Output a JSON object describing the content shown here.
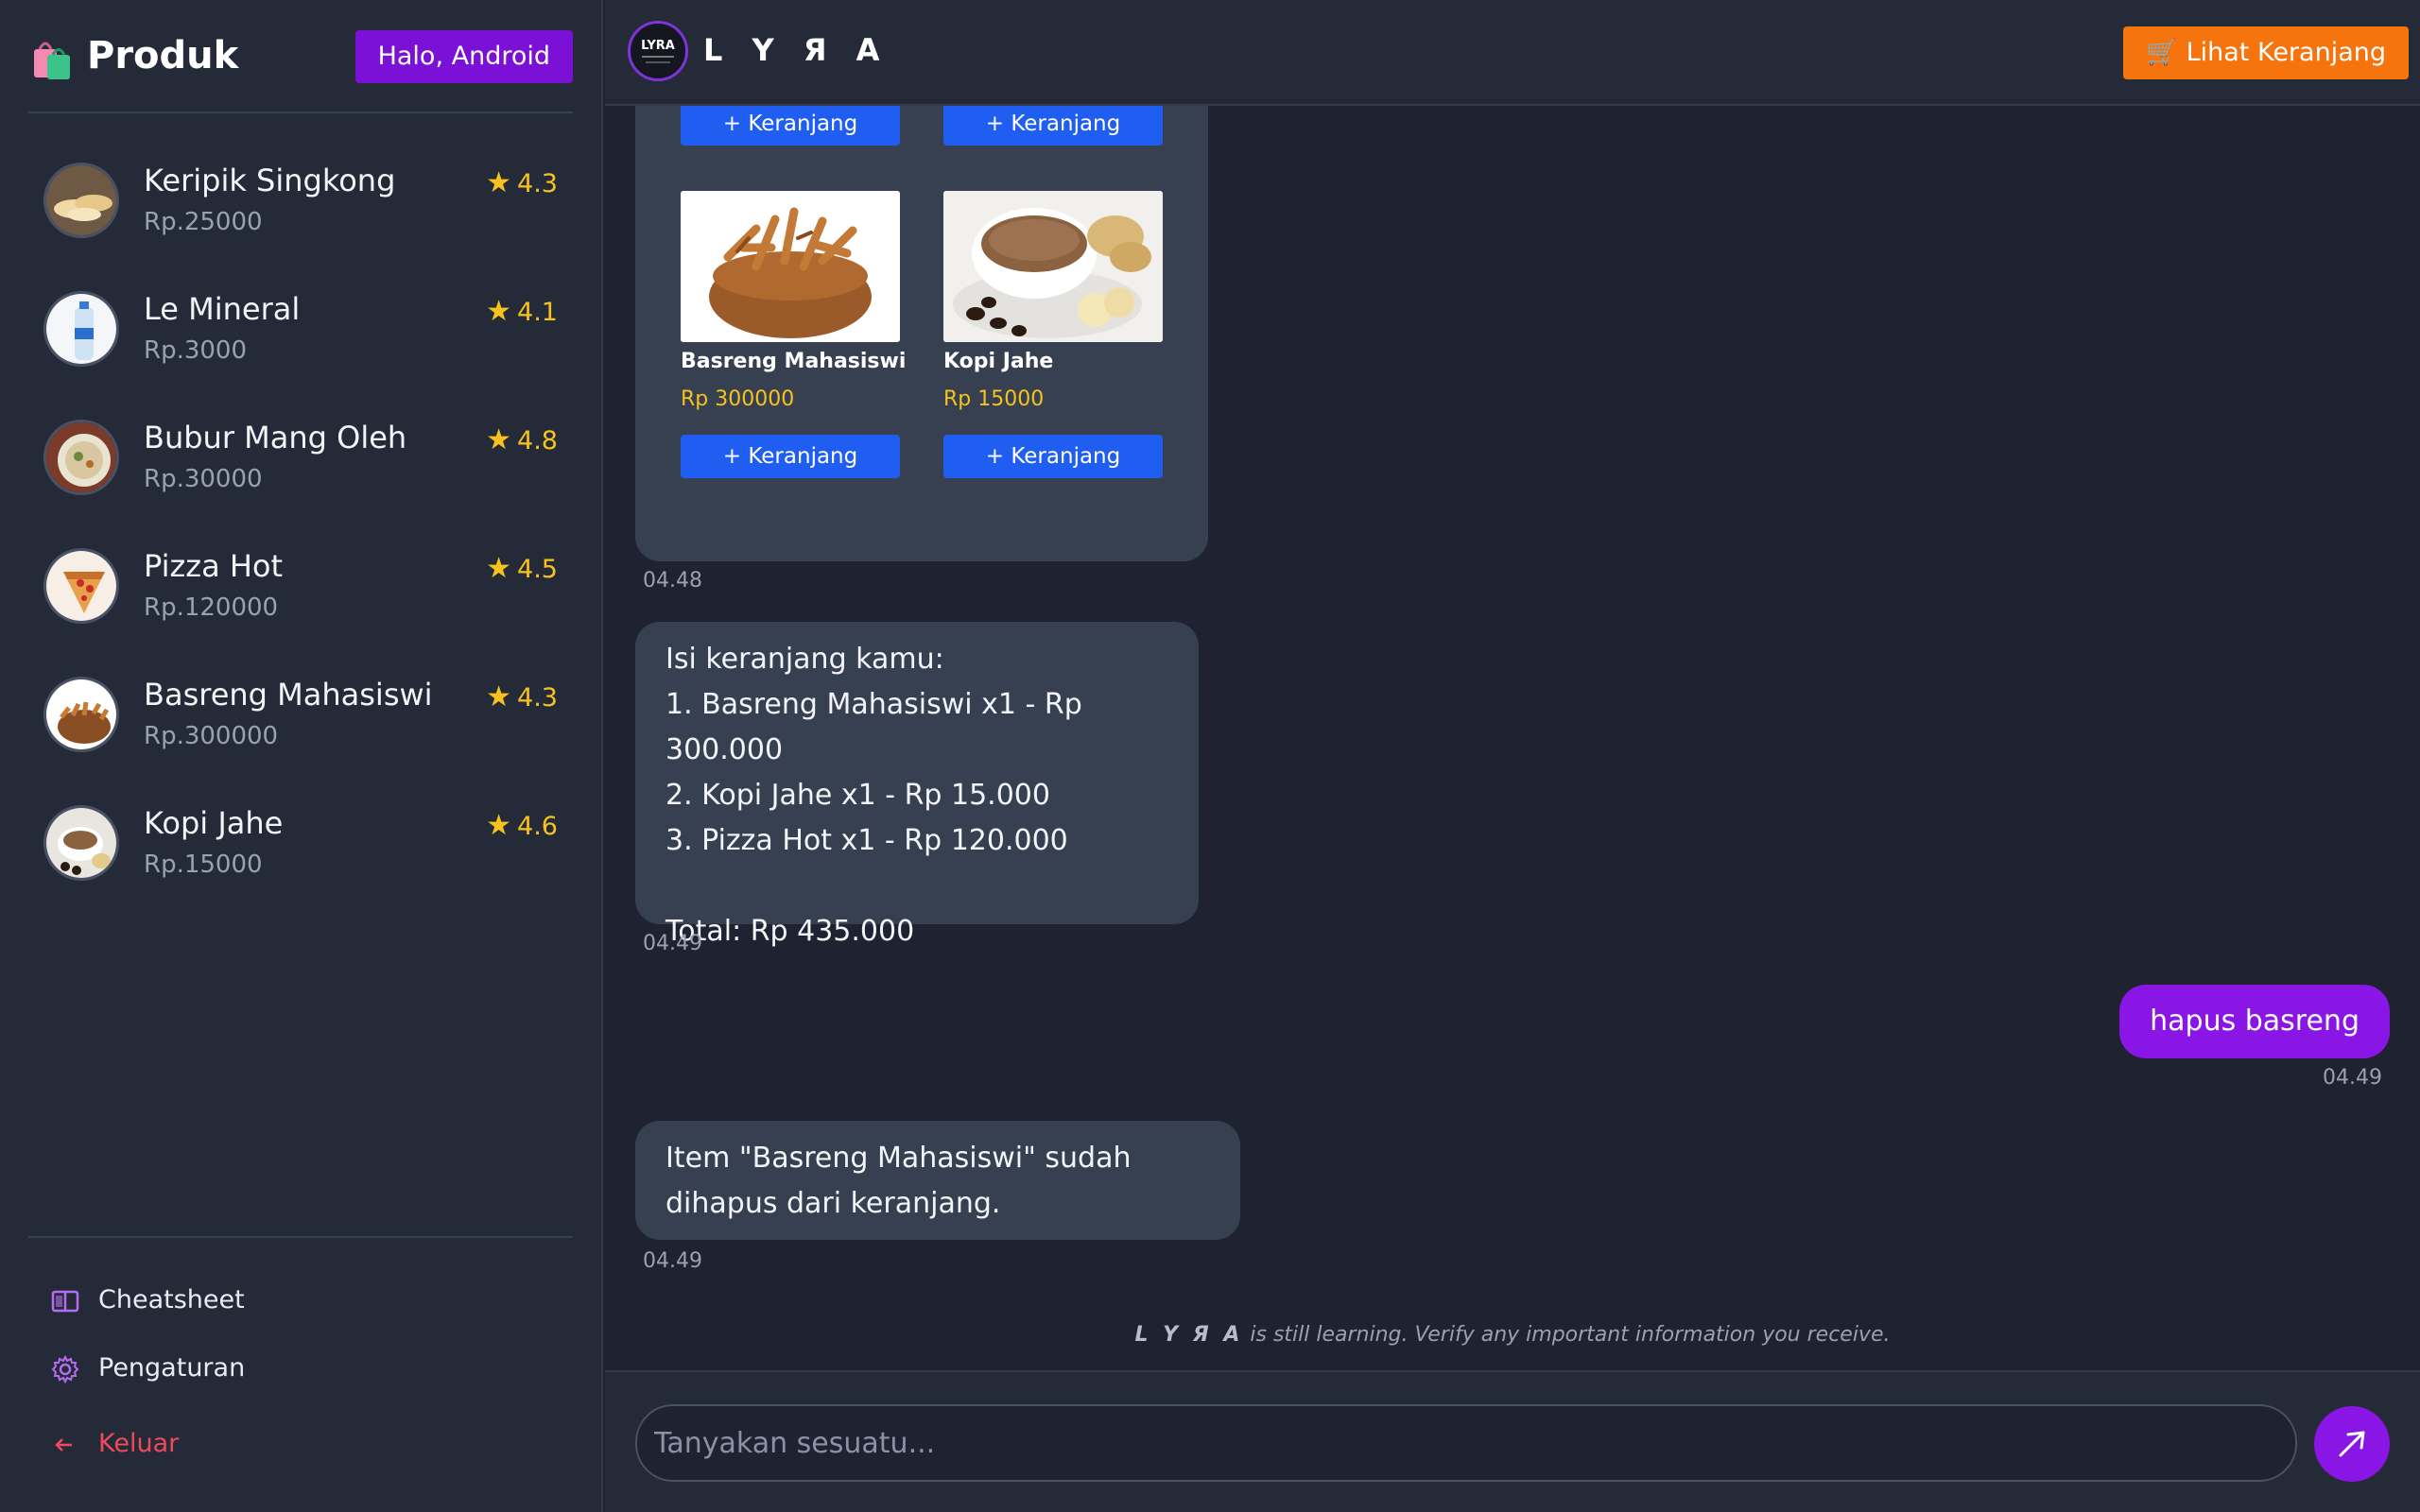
{
  "sidebar": {
    "title": "Produk",
    "greeting": "Halo, Android",
    "products": [
      {
        "name": "Keripik Singkong",
        "price": "Rp.25000",
        "rating": "4.3",
        "thumb": "chips"
      },
      {
        "name": "Le Mineral",
        "price": "Rp.3000",
        "rating": "4.1",
        "thumb": "water"
      },
      {
        "name": "Bubur Mang Oleh",
        "price": "Rp.30000",
        "rating": "4.8",
        "thumb": "porridge"
      },
      {
        "name": "Pizza Hot",
        "price": "Rp.120000",
        "rating": "4.5",
        "thumb": "pizza"
      },
      {
        "name": "Basreng Mahasiswi",
        "price": "Rp.300000",
        "rating": "4.3",
        "thumb": "basreng"
      },
      {
        "name": "Kopi Jahe",
        "price": "Rp.15000",
        "rating": "4.6",
        "thumb": "coffee"
      }
    ],
    "menu": {
      "cheatsheet": "Cheatsheet",
      "settings": "Pengaturan",
      "logout": "Keluar"
    }
  },
  "header": {
    "logo_text": "LYRA",
    "brand": "L Y Я A",
    "cart_button": "🛒 Lihat Keranjang"
  },
  "chat": {
    "product_cards": {
      "add_label": "+ Keranjang",
      "items": [
        {
          "name": "Basreng Mahasiswi",
          "price": "Rp 300000",
          "image": "basreng"
        },
        {
          "name": "Kopi Jahe",
          "price": "Rp 15000",
          "image": "coffee"
        }
      ],
      "time": "04.48"
    },
    "cart_message": {
      "lines": [
        "Isi keranjang kamu:",
        "1. Basreng Mahasiswi x1 - Rp 300.000",
        "2. Kopi Jahe x1 - Rp 15.000",
        "3. Pizza Hot x1 - Rp 120.000",
        "",
        "Total: Rp 435.000"
      ],
      "time": "04.49"
    },
    "user_message": {
      "text": "hapus basreng",
      "time": "04.49"
    },
    "bot_reply": {
      "lines": [
        "Item \"Basreng Mahasiswi\" sudah",
        "dihapus dari keranjang."
      ],
      "time": "04.49"
    }
  },
  "footer": {
    "disclaimer_brand": "L Y Я A",
    "disclaimer_text": " is still learning. Verify any important information you receive.",
    "input_placeholder": "Tanyakan sesuatu..."
  },
  "colors": {
    "accent": "#8a16e6",
    "cart_orange": "#f6740d",
    "add_blue": "#1f5ef0",
    "rating_gold": "#f6c31c",
    "logout_red": "#ef4a5b"
  }
}
